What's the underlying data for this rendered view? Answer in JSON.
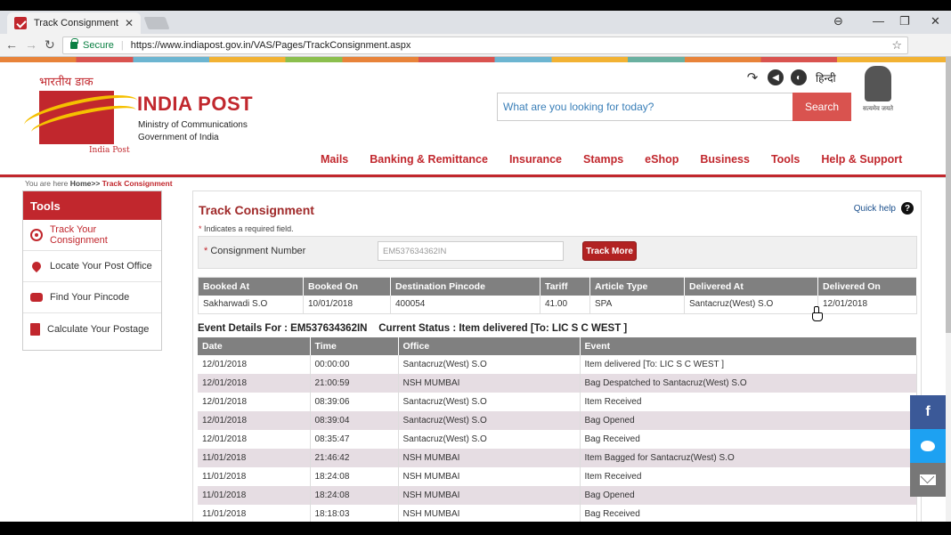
{
  "browser": {
    "tab_title": "Track Consignment",
    "tab_close": "✕",
    "secure_label": "Secure",
    "url": "https://www.indiapost.gov.in/VAS/Pages/TrackConsignment.aspx",
    "window_controls": [
      "⊖",
      "—",
      "❐",
      "✕"
    ]
  },
  "header": {
    "hindi_brand": "भारतीय डाक",
    "brand": "INDIA POST",
    "sub_brand": "India Post",
    "ministry_line1": "Ministry of Communications",
    "ministry_line2": "Government of India",
    "hindi_link": "हिन्दी",
    "emblem_caption": "सत्यमेव जयते",
    "search_placeholder": "What are you looking for today?",
    "search_button": "Search",
    "nav": [
      "Mails",
      "Banking & Remittance",
      "Insurance",
      "Stamps",
      "eShop",
      "Business",
      "Tools",
      "Help & Support"
    ]
  },
  "breadcrumb": {
    "prefix": "You are here",
    "home": "Home>>",
    "current": "Track Consignment"
  },
  "sidebar": {
    "title": "Tools",
    "items": [
      {
        "label": "Track Your Consignment",
        "icon": "target-icon"
      },
      {
        "label": "Locate Your Post Office",
        "icon": "location-pin-icon"
      },
      {
        "label": "Find Your Pincode",
        "icon": "binoculars-icon"
      },
      {
        "label": "Calculate Your Postage",
        "icon": "calculator-icon"
      }
    ]
  },
  "content": {
    "title": "Track Consignment",
    "quick_help": "Quick help",
    "required_note": "Indicates a required field.",
    "consignment_label": "Consignment Number",
    "consignment_value": "EM537634362IN",
    "track_more": "Track More",
    "booking_table": {
      "headers": [
        "Booked At",
        "Booked On",
        "Destination Pincode",
        "Tariff",
        "Article Type",
        "Delivered At",
        "Delivered On"
      ],
      "row": [
        "Sakharwadi S.O",
        "10/01/2018",
        "400054",
        "41.00",
        "SPA",
        "Santacruz(West) S.O",
        "12/01/2018"
      ]
    },
    "event_heading": "Event Details For : EM537634362IN    Current Status : Item delivered [To: LIC S C WEST ]",
    "event_table": {
      "headers": [
        "Date",
        "Time",
        "Office",
        "Event"
      ],
      "rows": [
        [
          "12/01/2018",
          "00:00:00",
          "Santacruz(West) S.O",
          "Item delivered [To: LIC S C WEST ]"
        ],
        [
          "12/01/2018",
          "21:00:59",
          "NSH MUMBAI",
          "Bag Despatched to Santacruz(West) S.O"
        ],
        [
          "12/01/2018",
          "08:39:06",
          "Santacruz(West) S.O",
          "Item Received"
        ],
        [
          "12/01/2018",
          "08:39:04",
          "Santacruz(West) S.O",
          "Bag Opened"
        ],
        [
          "12/01/2018",
          "08:35:47",
          "Santacruz(West) S.O",
          "Bag Received"
        ],
        [
          "11/01/2018",
          "21:46:42",
          "NSH MUMBAI",
          "Item Bagged for Santacruz(West) S.O"
        ],
        [
          "11/01/2018",
          "18:24:08",
          "NSH MUMBAI",
          "Item Received"
        ],
        [
          "11/01/2018",
          "18:24:08",
          "NSH MUMBAI",
          "Bag Opened"
        ],
        [
          "11/01/2018",
          "18:18:03",
          "NSH MUMBAI",
          "Bag Received"
        ]
      ]
    }
  },
  "social": {
    "facebook": "f"
  }
}
